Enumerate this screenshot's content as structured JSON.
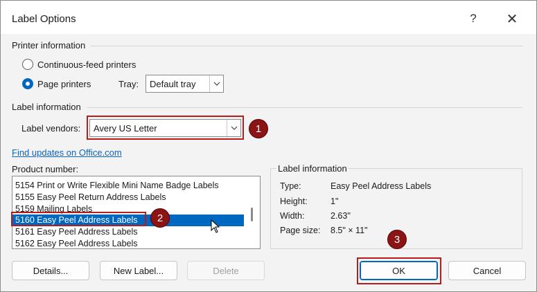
{
  "window": {
    "title": "Label Options",
    "help_label": "?",
    "close_label": "✕"
  },
  "printer_info": {
    "heading": "Printer information",
    "continuous_feed": "Continuous-feed printers",
    "page_printers": "Page printers",
    "tray_label": "Tray:",
    "tray_value": "Default tray",
    "selected": "page_printers"
  },
  "label_info": {
    "heading": "Label information",
    "vendors_label": "Label vendors:",
    "vendors_value": "Avery US Letter",
    "find_updates": "Find updates on Office.com",
    "product_number_label": "Product number:"
  },
  "products": [
    "5154 Print or Write Flexible Mini Name Badge Labels",
    "5155 Easy Peel Return Address Labels",
    "5159 Mailing Labels",
    "5160 Easy Peel Address Labels",
    "5161 Easy Peel Address Labels",
    "5162 Easy Peel Address Labels"
  ],
  "selected_product_index": 3,
  "label_details": {
    "heading": "Label information",
    "rows": [
      {
        "key": "Type:",
        "value": "Easy Peel Address Labels"
      },
      {
        "key": "Height:",
        "value": "1\""
      },
      {
        "key": "Width:",
        "value": "2.63\""
      },
      {
        "key": "Page size:",
        "value": "8.5\" × 11\""
      }
    ]
  },
  "buttons": {
    "details": "Details...",
    "new_label": "New Label...",
    "delete": "Delete",
    "ok": "OK",
    "cancel": "Cancel"
  },
  "annotations": {
    "step1": "1",
    "step2": "2",
    "step3": "3",
    "color": "#8b1414"
  },
  "icons": {
    "chevron": "chevron-down-icon",
    "cursor": "mouse-pointer-icon"
  }
}
